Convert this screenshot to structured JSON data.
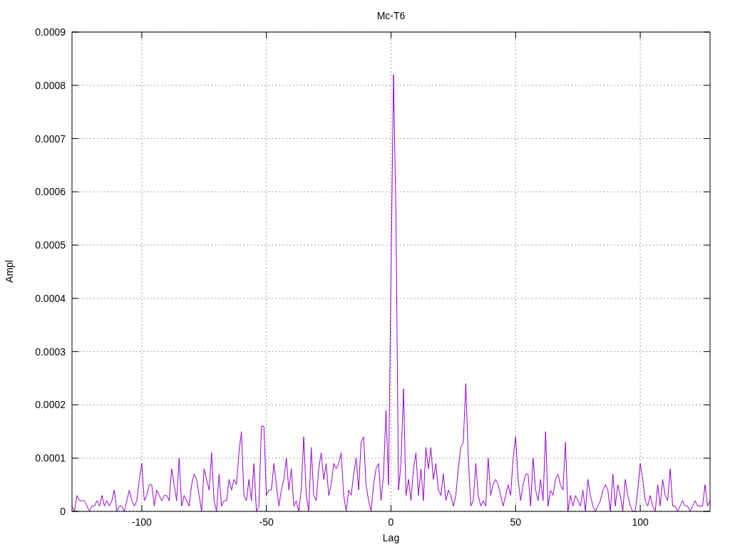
{
  "chart_data": {
    "type": "line",
    "title": "Mc-T6",
    "xlabel": "Lag",
    "ylabel": "Ampl",
    "grid": true,
    "xlim": [
      -128,
      128
    ],
    "ylim": [
      0,
      0.0009
    ],
    "xticks": [
      -100,
      -50,
      0,
      50,
      100
    ],
    "yticks": [
      0,
      0.0001,
      0.0002,
      0.0003,
      0.0004,
      0.0005,
      0.0006,
      0.0007,
      0.0008,
      0.0009
    ],
    "x": [
      -128,
      -127,
      -126,
      -125,
      -124,
      -123,
      -122,
      -121,
      -120,
      -119,
      -118,
      -117,
      -116,
      -115,
      -114,
      -113,
      -112,
      -111,
      -110,
      -109,
      -108,
      -107,
      -106,
      -105,
      -104,
      -103,
      -102,
      -101,
      -100,
      -99,
      -98,
      -97,
      -96,
      -95,
      -94,
      -93,
      -92,
      -91,
      -90,
      -89,
      -88,
      -87,
      -86,
      -85,
      -84,
      -83,
      -82,
      -81,
      -80,
      -79,
      -78,
      -77,
      -76,
      -75,
      -74,
      -73,
      -72,
      -71,
      -70,
      -69,
      -68,
      -67,
      -66,
      -65,
      -64,
      -63,
      -62,
      -61,
      -60,
      -59,
      -58,
      -57,
      -56,
      -55,
      -54,
      -53,
      -52,
      -51,
      -50,
      -49,
      -48,
      -47,
      -46,
      -45,
      -44,
      -43,
      -42,
      -41,
      -40,
      -39,
      -38,
      -37,
      -36,
      -35,
      -34,
      -33,
      -32,
      -31,
      -30,
      -29,
      -28,
      -27,
      -26,
      -25,
      -24,
      -23,
      -22,
      -21,
      -20,
      -19,
      -18,
      -17,
      -16,
      -15,
      -14,
      -13,
      -12,
      -11,
      -10,
      -9,
      -8,
      -7,
      -6,
      -5,
      -4,
      -3,
      -2,
      -1,
      0,
      1,
      2,
      3,
      4,
      5,
      6,
      7,
      8,
      9,
      10,
      11,
      12,
      13,
      14,
      15,
      16,
      17,
      18,
      19,
      20,
      21,
      22,
      23,
      24,
      25,
      26,
      27,
      28,
      29,
      30,
      31,
      32,
      33,
      34,
      35,
      36,
      37,
      38,
      39,
      40,
      41,
      42,
      43,
      44,
      45,
      46,
      47,
      48,
      49,
      50,
      51,
      52,
      53,
      54,
      55,
      56,
      57,
      58,
      59,
      60,
      61,
      62,
      63,
      64,
      65,
      66,
      67,
      68,
      69,
      70,
      71,
      72,
      73,
      74,
      75,
      76,
      77,
      78,
      79,
      80,
      81,
      82,
      83,
      84,
      85,
      86,
      87,
      88,
      89,
      90,
      91,
      92,
      93,
      94,
      95,
      96,
      97,
      98,
      99,
      100,
      101,
      102,
      103,
      104,
      105,
      106,
      107,
      108,
      109,
      110,
      111,
      112,
      113,
      114,
      115,
      116,
      117,
      118,
      119,
      120,
      121,
      122,
      123,
      124,
      125,
      126,
      127,
      128
    ],
    "series": [
      {
        "color": "#9400d3",
        "values": [
          1e-05,
          0,
          3e-05,
          2e-05,
          2e-05,
          2e-05,
          1e-05,
          0,
          1e-05,
          1e-05,
          2e-05,
          1e-05,
          3e-05,
          1e-05,
          2e-05,
          1e-05,
          2e-05,
          4e-05,
          0,
          1e-05,
          1e-05,
          0,
          2e-05,
          4e-05,
          2e-05,
          1e-05,
          2e-05,
          6e-05,
          9e-05,
          2e-05,
          3e-05,
          5e-05,
          5e-05,
          1e-05,
          4e-05,
          3e-05,
          2e-05,
          3e-05,
          3e-05,
          2e-05,
          8e-05,
          5e-05,
          2e-05,
          0.0001,
          1e-05,
          3e-05,
          2e-05,
          1e-05,
          5e-05,
          7e-05,
          6e-05,
          3e-05,
          0,
          8e-05,
          6e-05,
          4e-05,
          0.00011,
          2e-05,
          0,
          7e-05,
          1e-05,
          2e-05,
          2e-05,
          6e-05,
          4e-05,
          6e-05,
          5e-05,
          0.00011,
          0.00015,
          3e-05,
          2e-05,
          6e-05,
          2e-05,
          9e-05,
          0,
          1e-05,
          0.00016,
          0.00016,
          3e-05,
          4e-05,
          4e-05,
          9e-05,
          5e-05,
          1e-05,
          4e-05,
          6e-05,
          0.0001,
          4e-05,
          8e-05,
          1e-05,
          2e-05,
          0,
          4e-05,
          0.00014,
          3e-05,
          0,
          0.00012,
          3e-05,
          2e-05,
          8e-05,
          0.00011,
          6e-05,
          9e-05,
          3e-05,
          5e-05,
          9e-05,
          8e-05,
          9e-05,
          0.00011,
          3e-05,
          0,
          4e-05,
          3e-05,
          7e-05,
          0.0001,
          4e-05,
          0.00013,
          0.00014,
          5e-05,
          2e-05,
          0,
          5e-05,
          8e-05,
          9e-05,
          2e-05,
          7e-05,
          0.00019,
          5e-05,
          0.00045,
          0.00082,
          0.00055,
          4e-05,
          9e-05,
          0.00023,
          3e-05,
          6e-05,
          2e-05,
          8e-05,
          0.00011,
          3e-05,
          8e-05,
          2e-05,
          0.00012,
          8e-05,
          0.00012,
          6e-05,
          9e-05,
          4e-05,
          3e-05,
          7e-05,
          2e-05,
          4e-05,
          3e-05,
          1e-05,
          3e-05,
          8e-05,
          0.00012,
          0.00013,
          0.00024,
          0.0001,
          1e-05,
          2e-05,
          9e-05,
          3e-05,
          1e-05,
          2e-05,
          1e-05,
          0.0001,
          3e-05,
          5e-05,
          6e-05,
          5e-05,
          3e-05,
          1e-05,
          3e-05,
          5e-05,
          3e-05,
          0.0001,
          0.00014,
          6e-05,
          2e-05,
          5e-05,
          7e-05,
          7e-05,
          1e-05,
          0.0001,
          4e-05,
          2e-05,
          6e-05,
          2e-05,
          0.00015,
          1e-05,
          4e-05,
          3e-05,
          6e-05,
          7e-05,
          5e-05,
          4e-05,
          0.00013,
          0,
          3e-05,
          1e-05,
          3e-05,
          2e-05,
          1e-05,
          4e-05,
          0,
          6e-05,
          3e-05,
          1e-05,
          0,
          1e-05,
          2e-05,
          4e-05,
          5e-05,
          4e-05,
          0,
          7e-05,
          1e-05,
          5e-05,
          3e-05,
          0,
          6e-05,
          3e-05,
          1e-05,
          0,
          0,
          4e-05,
          9e-05,
          6e-05,
          2e-05,
          1e-05,
          3e-05,
          1e-05,
          0,
          5e-05,
          1e-05,
          6e-05,
          3e-05,
          2e-05,
          8e-05,
          1e-05,
          1e-05,
          0,
          1e-05,
          2e-05,
          1e-05,
          1e-05,
          0,
          1e-05,
          2e-05,
          1e-05,
          1e-05,
          1e-05,
          5e-05,
          1e-05,
          2e-05
        ]
      }
    ]
  }
}
